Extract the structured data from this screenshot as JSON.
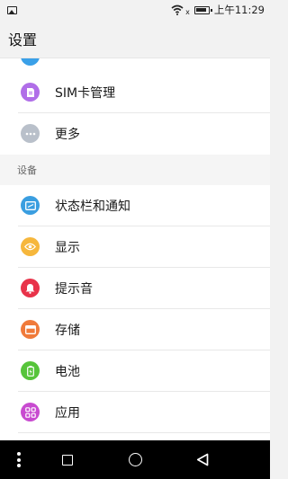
{
  "status_bar": {
    "time": "上午11:29",
    "icons": [
      "gallery-icon",
      "wifi-icon",
      "battery-icon"
    ]
  },
  "header": {
    "title": "设置"
  },
  "sections": [
    {
      "items": [
        {
          "label": "SIM卡管理",
          "icon": "sim-card-icon",
          "color": "#b06ee8"
        },
        {
          "label": "更多",
          "icon": "more-icon",
          "color": "#b9c0ca"
        }
      ]
    },
    {
      "header": "设备",
      "items": [
        {
          "label": "状态栏和通知",
          "icon": "status-bar-icon",
          "color": "#3a9ee0"
        },
        {
          "label": "显示",
          "icon": "eye-icon",
          "color": "#f6b73c"
        },
        {
          "label": "提示音",
          "icon": "bell-icon",
          "color": "#e8334a"
        },
        {
          "label": "存储",
          "icon": "storage-icon",
          "color": "#f07a3a"
        },
        {
          "label": "电池",
          "icon": "battery-icon",
          "color": "#56c43a"
        },
        {
          "label": "应用",
          "icon": "apps-icon",
          "color": "#c84bd0"
        }
      ]
    }
  ],
  "nav_bar": {
    "buttons": [
      "menu-dots-icon",
      "recent-apps-icon",
      "home-icon",
      "back-icon"
    ]
  }
}
